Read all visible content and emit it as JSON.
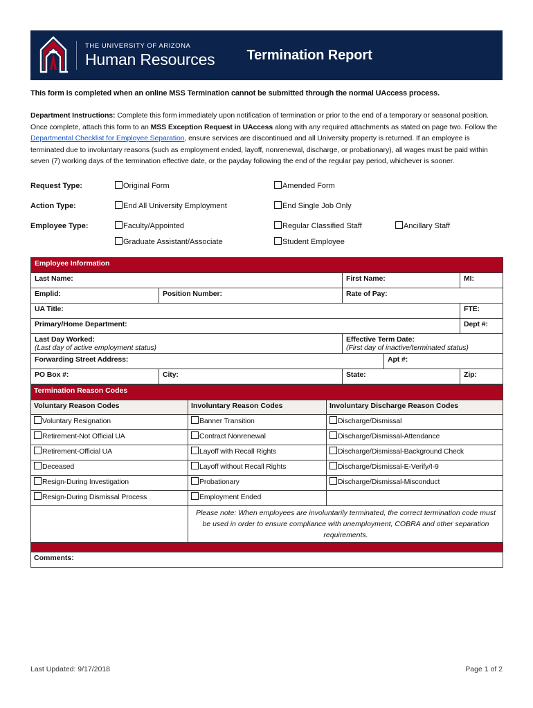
{
  "header": {
    "brand_line1": "THE UNIVERSITY OF ARIZONA",
    "brand_line2": "Human Resources",
    "title": "Termination Report",
    "logo_icon": "arizona-block-a-logo",
    "navy": "#0C234B",
    "red": "#AB0520"
  },
  "intro": {
    "lead": "This form is completed when an online MSS Termination cannot be submitted through the normal UAccess process.",
    "instructions_label": "Department Instructions:",
    "instructions_p1": " Complete this form immediately upon notification of termination or prior to the end of a temporary or seasonal position.  Once complete, attach this form to an ",
    "instructions_bold1": "MSS Exception Request in UAccess",
    "instructions_p2": " along with any required attachments as stated on page two.  Follow the ",
    "link_text": "Departmental Checklist for Employee Separation",
    "link_color": "#1155CC",
    "instructions_p3": ", ensure services are discontinued and all University property is returned.  If an employee is terminated due to involuntary reasons (such as employment ended, layoff, nonrenewal, discharge, or probationary), all wages must be paid within seven (7) working days of the termination effective date, or the payday following the end of the regular pay period, whichever is sooner."
  },
  "types": {
    "request": {
      "label": "Request Type:",
      "options": [
        "Original Form",
        "Amended Form"
      ]
    },
    "action": {
      "label": "Action Type:",
      "options": [
        "End All University Employment",
        "End Single Job Only"
      ]
    },
    "employee": {
      "label": "Employee Type:",
      "row1": [
        "Faculty/Appointed",
        "Regular Classified Staff",
        "Ancillary Staff"
      ],
      "row2": [
        "Graduate Assistant/Associate",
        "Student Employee"
      ]
    }
  },
  "employee_information": {
    "section_title": "Employee Information",
    "last_name": "Last Name:",
    "first_name": "First Name:",
    "mi": "MI:",
    "emplid": "Emplid:",
    "position_number": "Position Number:",
    "rate_of_pay": "Rate of Pay:",
    "ua_title": "UA Title:",
    "fte": "FTE:",
    "primary_home_department": "Primary/Home Department:",
    "dept_number": "Dept #:",
    "last_day_worked": "Last Day Worked:",
    "last_day_worked_sub": "(Last day of active employment status)",
    "effective_term_date": "Effective Term Date:",
    "effective_term_date_sub": "(First day of inactive/terminated status)",
    "forwarding_street_address": "Forwarding Street Address:",
    "apt_number": "Apt #:",
    "po_box": "PO Box #:",
    "city": "City:",
    "state": "State:",
    "zip": "Zip:"
  },
  "termination_reason_codes": {
    "section_title": "Termination Reason Codes",
    "columns": [
      "Voluntary Reason Codes",
      "Involuntary Reason Codes",
      "Involuntary Discharge Reason Codes"
    ],
    "voluntary": [
      "Voluntary Resignation",
      "Retirement-Not Official UA",
      "Retirement-Official UA",
      "Deceased",
      "Resign-During Investigation",
      "Resign-During Dismissal Process"
    ],
    "involuntary": [
      "Banner Transition",
      "Contract Nonrenewal",
      "Layoff with Recall Rights",
      "Layoff without Recall Rights",
      "Probationary",
      "Employment Ended"
    ],
    "involuntary_discharge": [
      "Discharge/Dismissal",
      "Discharge/Dismissal-Attendance",
      "Discharge/Dismissal-Background Check",
      "Discharge/Dismissal-E-Verify/I-9",
      "Discharge/Dismissal-Misconduct"
    ],
    "note": "Please note: When employees are involuntarily terminated, the correct termination code must be used in order to ensure compliance with unemployment, COBRA and other separation requirements."
  },
  "comments": {
    "label": "Comments:"
  },
  "footer": {
    "last_updated": "Last Updated:  9/17/2018",
    "page": "Page 1 of 2"
  }
}
